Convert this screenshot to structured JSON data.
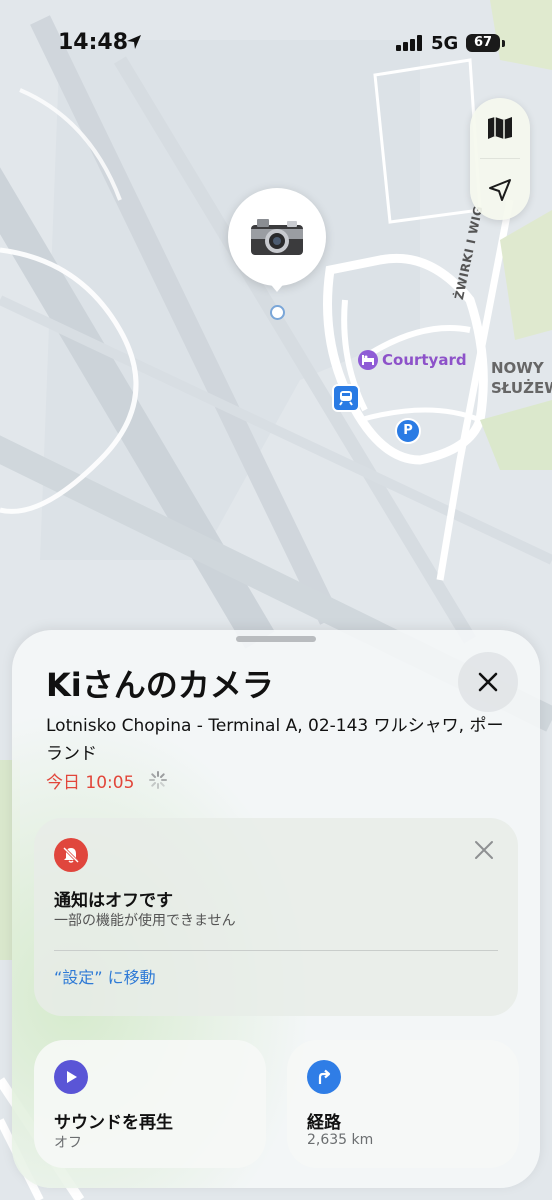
{
  "status_bar": {
    "time": "14:48",
    "network": "5G",
    "battery": "67"
  },
  "map": {
    "poi_hotel": "Courtyard",
    "street": "ŻWIRKI I WIG",
    "district_line1": "NOWY",
    "district_line2": "SŁUŻEW",
    "parking_letter": "P"
  },
  "sheet": {
    "title": "Kiさんのカメラ",
    "address": "Lotnisko Chopina - Terminal A, 02-143 ワルシャワ, ポーランド",
    "last_seen": "今日 10:05",
    "notification": {
      "heading": "通知はオフです",
      "subtext": "一部の機能が使用できません",
      "link": "“設定” に移動"
    },
    "actions": {
      "sound_label": "サウンドを再生",
      "sound_value": "オフ",
      "route_label": "経路",
      "route_value": "2,635 km"
    }
  },
  "colors": {
    "accent_red": "#e2463a",
    "link_blue": "#2e7ad6",
    "hotel_purple": "#8d52c9",
    "sound_purple": "#5a55d6",
    "route_blue": "#2f7de6"
  },
  "icons": {
    "map_mode": "map-icon",
    "locate": "location-arrow-icon",
    "close": "close-icon",
    "bell_off": "bell-slash-icon",
    "play": "play-icon",
    "route": "turn-right-arrow-icon",
    "device": "camera-icon"
  }
}
